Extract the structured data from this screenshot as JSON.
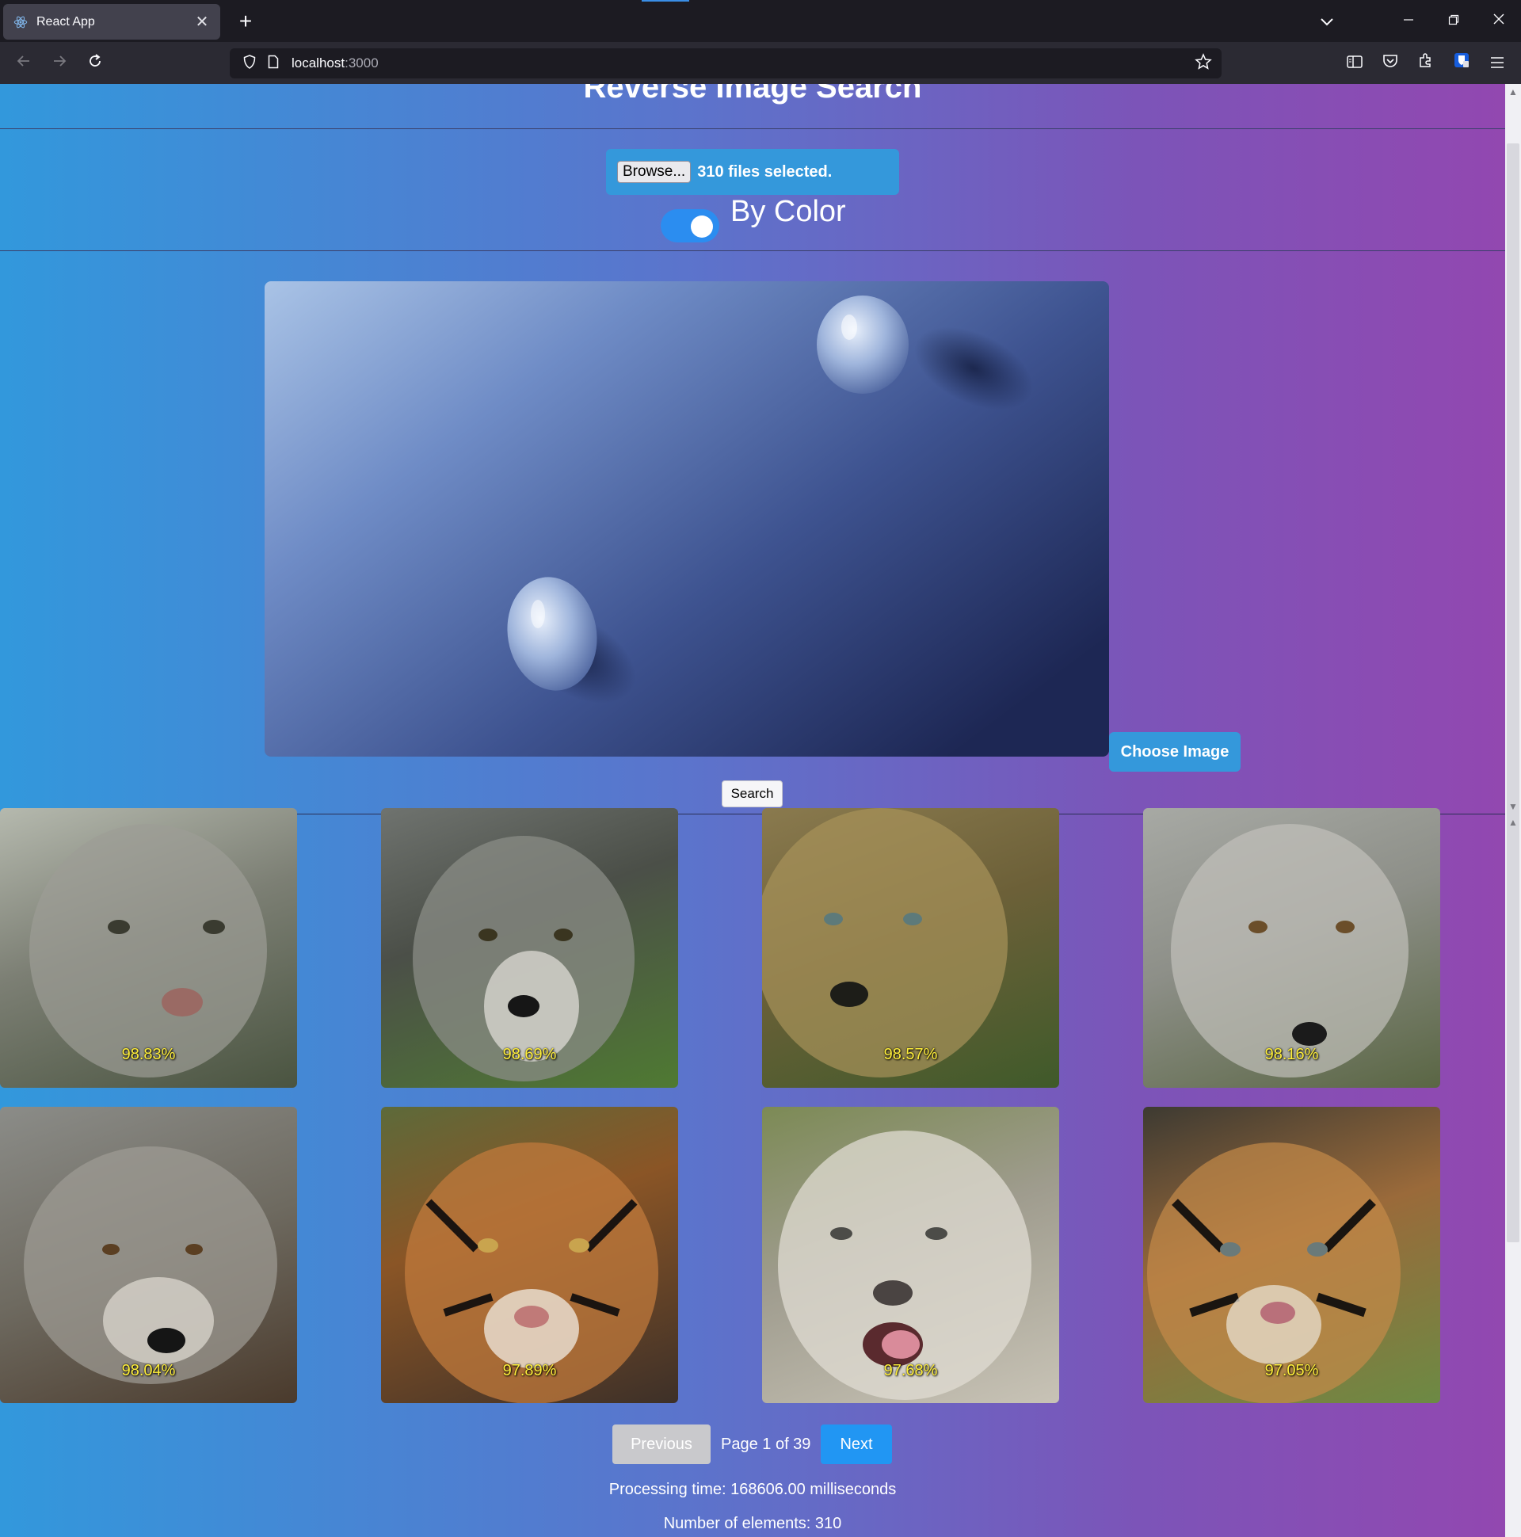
{
  "browser": {
    "tab_title": "React App",
    "url_host": "localhost",
    "url_port": ":3000",
    "icons": {
      "favicon": "react-icon",
      "close": "close-icon",
      "new_tab": "plus-icon",
      "tab_list": "chevron-down-icon",
      "minimize": "minimize-icon",
      "restore": "restore-icon",
      "close_window": "close-icon",
      "back": "back-arrow-icon",
      "forward": "forward-arrow-icon",
      "reload": "reload-icon",
      "shield": "shield-icon",
      "page": "page-icon",
      "bookmark": "star-icon",
      "sidebar": "sidebar-icon",
      "pocket": "pocket-icon",
      "extensions": "puzzle-icon",
      "bitwarden": "bitwarden-icon",
      "menu": "hamburger-menu-icon"
    }
  },
  "page": {
    "title": "Reverse Image Search",
    "browse_label": "Browse...",
    "files_selected": "310 files selected.",
    "toggle_label": "By Color",
    "toggle_on": true,
    "choose_image_label": "Choose Image",
    "search_label": "Search"
  },
  "results": [
    {
      "score": "98.83%",
      "animal": "snow-leopard"
    },
    {
      "score": "98.69%",
      "animal": "wolf"
    },
    {
      "score": "98.57%",
      "animal": "leopard"
    },
    {
      "score": "98.16%",
      "animal": "wolf"
    },
    {
      "score": "98.04%",
      "animal": "wolf"
    },
    {
      "score": "97.89%",
      "animal": "tiger"
    },
    {
      "score": "97.68%",
      "animal": "snow-leopard"
    },
    {
      "score": "97.05%",
      "animal": "tiger"
    }
  ],
  "pagination": {
    "previous_label": "Previous",
    "page_text": "Page 1 of 39",
    "next_label": "Next"
  },
  "stats": {
    "processing_time": "Processing time: 168606.00 milliseconds",
    "element_count": "Number of elements: 310"
  },
  "colors": {
    "accent": "#3498db",
    "next_button": "#2196f3",
    "score_text": "#ffef3a"
  }
}
